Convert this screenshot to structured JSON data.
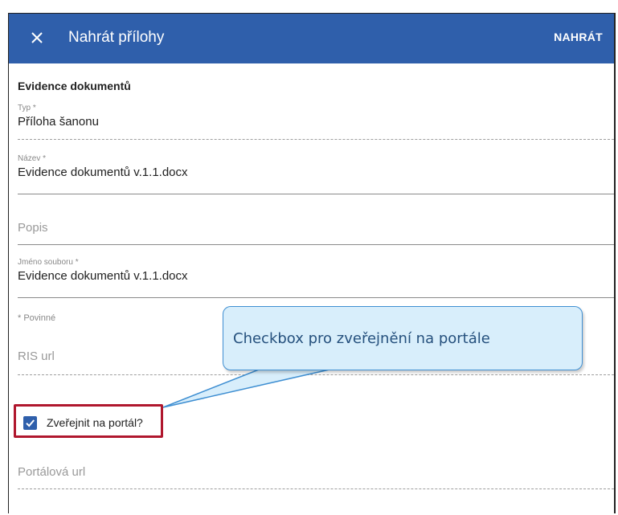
{
  "dialog": {
    "title": "Nahrát přílohy",
    "action_label": "NAHRÁT",
    "close_icon": "close-icon",
    "colors": {
      "appbar": "#2f5fab",
      "checkbox": "#2f5fab",
      "highlight": "#b0172e",
      "callout_bg": "#d8eefb"
    }
  },
  "form": {
    "section_title": "Evidence dokumentů",
    "fields": {
      "typ": {
        "label": "Typ *",
        "value": "Příloha šanonu"
      },
      "nazev": {
        "label": "Název *",
        "value": "Evidence dokumentů v.1.1.docx"
      },
      "popis": {
        "placeholder": "Popis"
      },
      "jmeno_souboru": {
        "label": "Jméno souboru *",
        "value": "Evidence dokumentů v.1.1.docx"
      },
      "ris_url": {
        "placeholder": "RIS url"
      },
      "portalova_url": {
        "placeholder": "Portálová url"
      }
    },
    "required_note": "* Povinné",
    "publish_checkbox": {
      "label": "Zveřejnit na portál?",
      "checked": true
    }
  },
  "annotation": {
    "callout_text": "Checkbox pro zveřejnění na portále"
  }
}
